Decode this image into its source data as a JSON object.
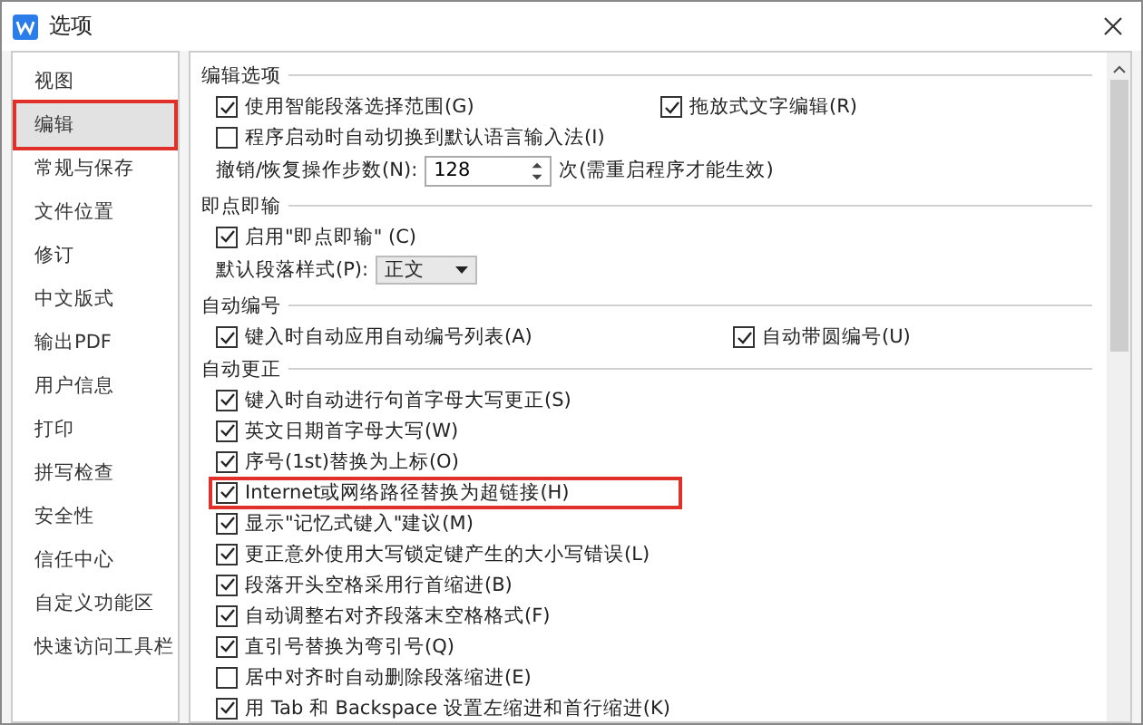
{
  "window": {
    "title": "选项"
  },
  "sidebar": {
    "items": [
      {
        "label": "视图",
        "selected": false,
        "highlighted": false
      },
      {
        "label": "编辑",
        "selected": true,
        "highlighted": true
      },
      {
        "label": "常规与保存",
        "selected": false,
        "highlighted": false
      },
      {
        "label": "文件位置",
        "selected": false,
        "highlighted": false
      },
      {
        "label": "修订",
        "selected": false,
        "highlighted": false
      },
      {
        "label": "中文版式",
        "selected": false,
        "highlighted": false
      },
      {
        "label": "输出PDF",
        "selected": false,
        "highlighted": false
      },
      {
        "label": "用户信息",
        "selected": false,
        "highlighted": false
      },
      {
        "label": "打印",
        "selected": false,
        "highlighted": false
      },
      {
        "label": "拼写检查",
        "selected": false,
        "highlighted": false
      },
      {
        "label": "安全性",
        "selected": false,
        "highlighted": false
      },
      {
        "label": "信任中心",
        "selected": false,
        "highlighted": false
      },
      {
        "label": "自定义功能区",
        "selected": false,
        "highlighted": false
      },
      {
        "label": "快速访问工具栏",
        "selected": false,
        "highlighted": false
      }
    ]
  },
  "sections": [
    {
      "title": "编辑选项",
      "rows": [
        {
          "kind": "checkbox",
          "label": "使用智能段落选择范围(G)",
          "checked": true,
          "highlighted": false,
          "right": {
            "label": "拖放式文字编辑(R)",
            "checked": true
          }
        },
        {
          "kind": "checkbox",
          "label": "程序启动时自动切换到默认语言输入法(I)",
          "checked": false,
          "highlighted": false
        },
        {
          "kind": "spinner",
          "label": "撤销/恢复操作步数(N):",
          "value": "128",
          "note": "次(需重启程序才能生效)"
        }
      ]
    },
    {
      "title": "即点即输",
      "rows": [
        {
          "kind": "checkbox",
          "label": "启用\"即点即输\" (C)",
          "checked": true,
          "highlighted": false
        },
        {
          "kind": "select",
          "label": "默认段落样式(P):",
          "value": "正文"
        }
      ]
    },
    {
      "title": "自动编号",
      "rows": [
        {
          "kind": "checkbox",
          "label": "键入时自动应用自动编号列表(A)",
          "checked": true,
          "highlighted": false,
          "right": {
            "label": "自动带圆编号(U)",
            "checked": true
          }
        }
      ]
    },
    {
      "title": "自动更正",
      "rows": [
        {
          "kind": "checkbox",
          "label": "键入时自动进行句首字母大写更正(S)",
          "checked": true,
          "highlighted": false
        },
        {
          "kind": "checkbox",
          "label": "英文日期首字母大写(W)",
          "checked": true,
          "highlighted": false
        },
        {
          "kind": "checkbox",
          "label": "序号(1st)替换为上标(O)",
          "checked": true,
          "highlighted": false
        },
        {
          "kind": "checkbox",
          "label": "Internet或网络路径替换为超链接(H)",
          "checked": true,
          "highlighted": true
        },
        {
          "kind": "checkbox",
          "label": "显示\"记忆式键入\"建议(M)",
          "checked": true,
          "highlighted": false
        },
        {
          "kind": "checkbox",
          "label": "更正意外使用大写锁定键产生的大小写错误(L)",
          "checked": true,
          "highlighted": false
        },
        {
          "kind": "checkbox",
          "label": "段落开头空格采用行首缩进(B)",
          "checked": true,
          "highlighted": false
        },
        {
          "kind": "checkbox",
          "label": "自动调整右对齐段落末空格格式(F)",
          "checked": true,
          "highlighted": false
        },
        {
          "kind": "checkbox",
          "label": "直引号替换为弯引号(Q)",
          "checked": true,
          "highlighted": false
        },
        {
          "kind": "checkbox",
          "label": "居中对齐时自动删除段落缩进(E)",
          "checked": false,
          "highlighted": false
        },
        {
          "kind": "checkbox",
          "label": "用 Tab 和 Backspace 设置左缩进和首行缩进(K)",
          "checked": true,
          "highlighted": false
        }
      ]
    }
  ]
}
